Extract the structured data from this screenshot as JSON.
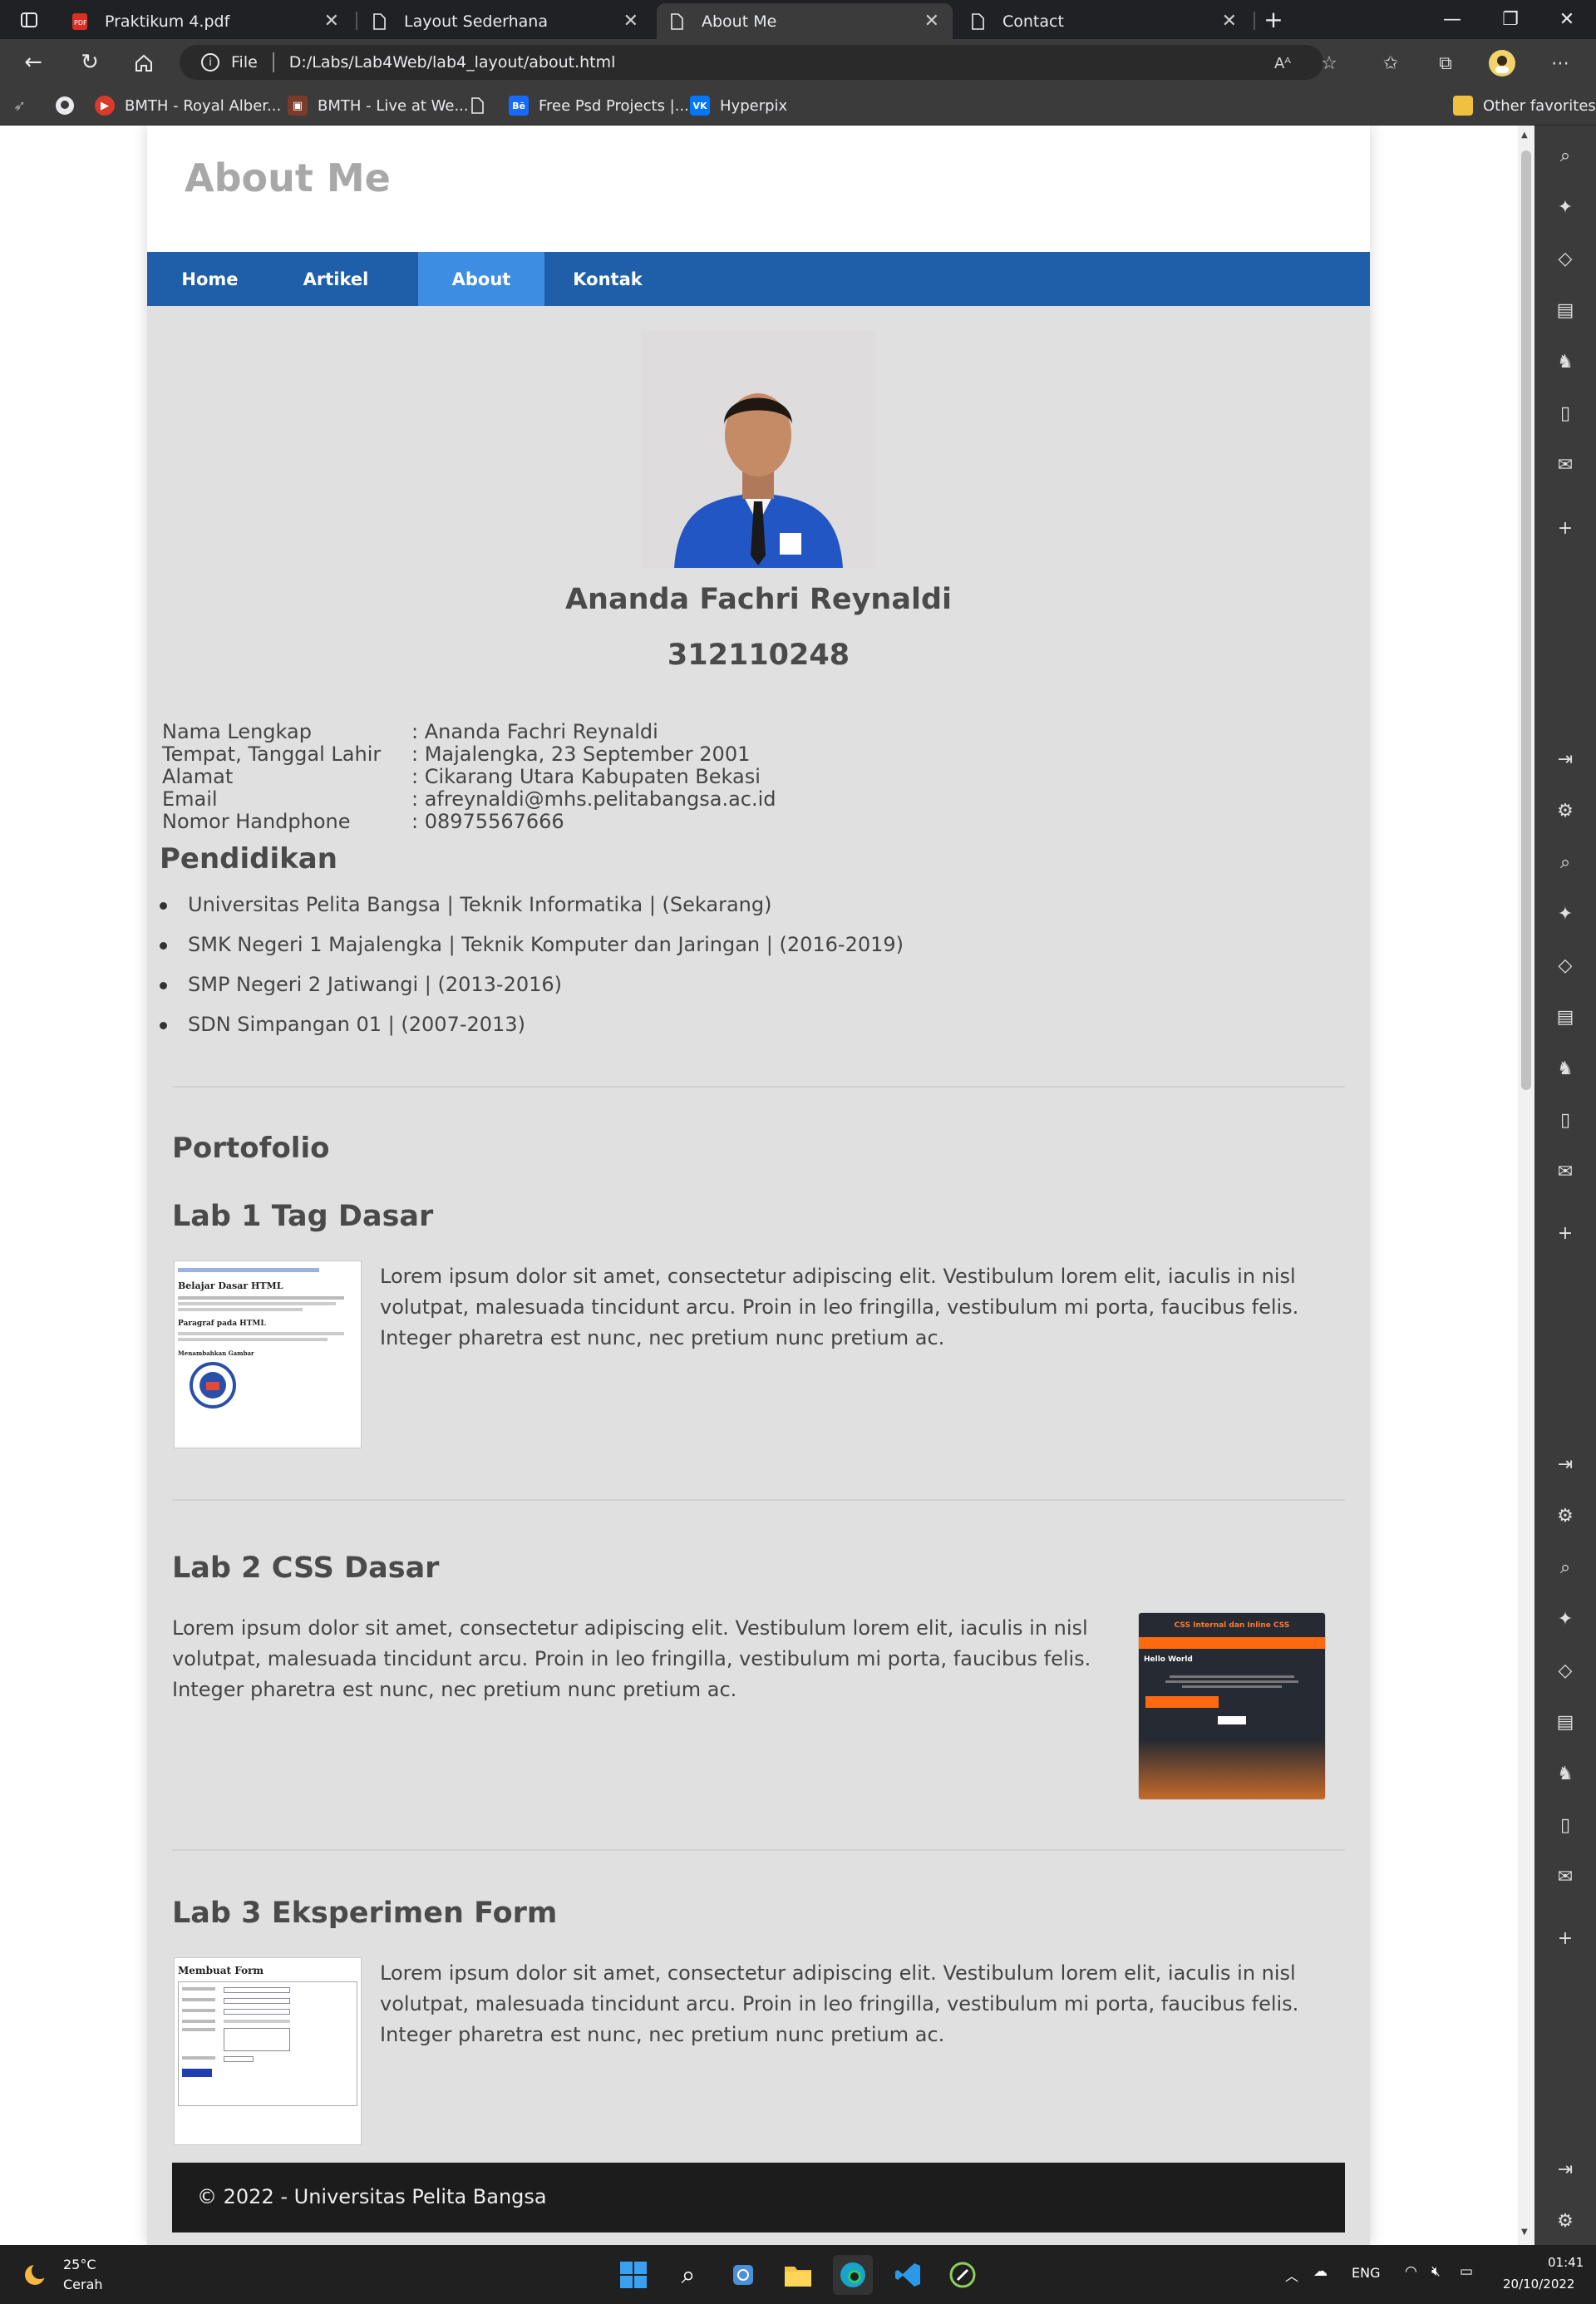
{
  "browser": {
    "tabs": [
      {
        "label": "Praktikum 4.pdf",
        "icon": "pdf-icon",
        "active": false
      },
      {
        "label": "Layout Sederhana",
        "icon": "page-icon",
        "active": false
      },
      {
        "label": "About Me",
        "icon": "page-icon",
        "active": true
      },
      {
        "label": "Contact",
        "icon": "page-icon",
        "active": false
      }
    ],
    "address": {
      "scheme_label": "File",
      "url": "D:/Labs/Lab4Web/lab4_layout/about.html"
    },
    "favorites": [
      {
        "label": "BMTH - Royal Alber...",
        "icon": "youtube-icon"
      },
      {
        "label": "BMTH - Live at We...",
        "icon": "bookmark-icon"
      },
      {
        "label": "Free Psd Projects |...",
        "icon": "behance-icon"
      },
      {
        "label": "Hyperpix",
        "icon": "vk-icon"
      }
    ],
    "other_favorites": "Other favorites"
  },
  "site": {
    "title": "About Me",
    "nav": [
      {
        "label": "Home",
        "active": false
      },
      {
        "label": "Artikel",
        "active": false
      },
      {
        "label": "About",
        "active": true
      },
      {
        "label": "Kontak",
        "active": false
      }
    ],
    "profile": {
      "name": "Ananda Fachri Reynaldi",
      "nim": "312110248",
      "info": [
        {
          "label": "Nama Lengkap",
          "value": ": Ananda Fachri Reynaldi"
        },
        {
          "label": "Tempat, Tanggal Lahir",
          "value": ": Majalengka, 23 September 2001"
        },
        {
          "label": "Alamat",
          "value": ": Cikarang Utara Kabupaten Bekasi"
        },
        {
          "label": "Email",
          "value": ": afreynaldi@mhs.pelitabangsa.ac.id"
        },
        {
          "label": "Nomor Handphone",
          "value": ": 08975567666"
        }
      ]
    },
    "education": {
      "heading": "Pendidikan",
      "items": [
        "Universitas Pelita Bangsa | Teknik Informatika | (Sekarang)",
        "SMK Negeri 1 Majalengka | Teknik Komputer dan Jaringan | (2016-2019)",
        "SMP Negeri 2 Jatiwangi | (2013-2016)",
        "SDN Simpangan 01 | (2007-2013)"
      ]
    },
    "portfolio": {
      "heading": "Portofolio",
      "labs": [
        {
          "title": "Lab 1 Tag Dasar",
          "text": "Lorem ipsum dolor sit amet, consectetur adipiscing elit. Vestibulum lorem elit, iaculis in nisl volutpat, malesuada tincidunt arcu. Proin in leo fringilla, vestibulum mi porta, faucibus felis. Integer pharetra est nunc, nec pretium nunc pretium ac."
        },
        {
          "title": "Lab 2 CSS Dasar",
          "text": "Lorem ipsum dolor sit amet, consectetur adipiscing elit. Vestibulum lorem elit, iaculis in nisl volutpat, malesuada tincidunt arcu. Proin in leo fringilla, vestibulum mi porta, faucibus felis. Integer pharetra est nunc, nec pretium nunc pretium ac."
        },
        {
          "title": "Lab 3 Eksperimen Form",
          "text": "Lorem ipsum dolor sit amet, consectetur adipiscing elit. Vestibulum lorem elit, iaculis in nisl volutpat, malesuada tincidunt arcu. Proin in leo fringilla, vestibulum mi porta, faucibus felis. Integer pharetra est nunc, nec pretium nunc pretium ac."
        }
      ],
      "thumb_text": {
        "lab1_heading": "Belajar Dasar HTML",
        "lab1_sub1": "Paragraf pada HTML",
        "lab1_sub2": "Menambahkan Gambar",
        "lab2_heading": "CSS Internal dan Inline CSS",
        "lab2_hello": "Hello World",
        "lab3_heading": "Membuat Form"
      }
    },
    "footer": "© 2022 - Universitas Pelita Bangsa"
  },
  "taskbar": {
    "weather_temp": "25°C",
    "weather_desc": "Cerah",
    "lang": "ENG",
    "time": "01:41",
    "date": "20/10/2022"
  },
  "colors": {
    "nav_bg": "#1f5faa",
    "nav_active": "#3d8de3",
    "page_bg": "#e0e0e0",
    "footer_bg": "#1c1c1c"
  }
}
